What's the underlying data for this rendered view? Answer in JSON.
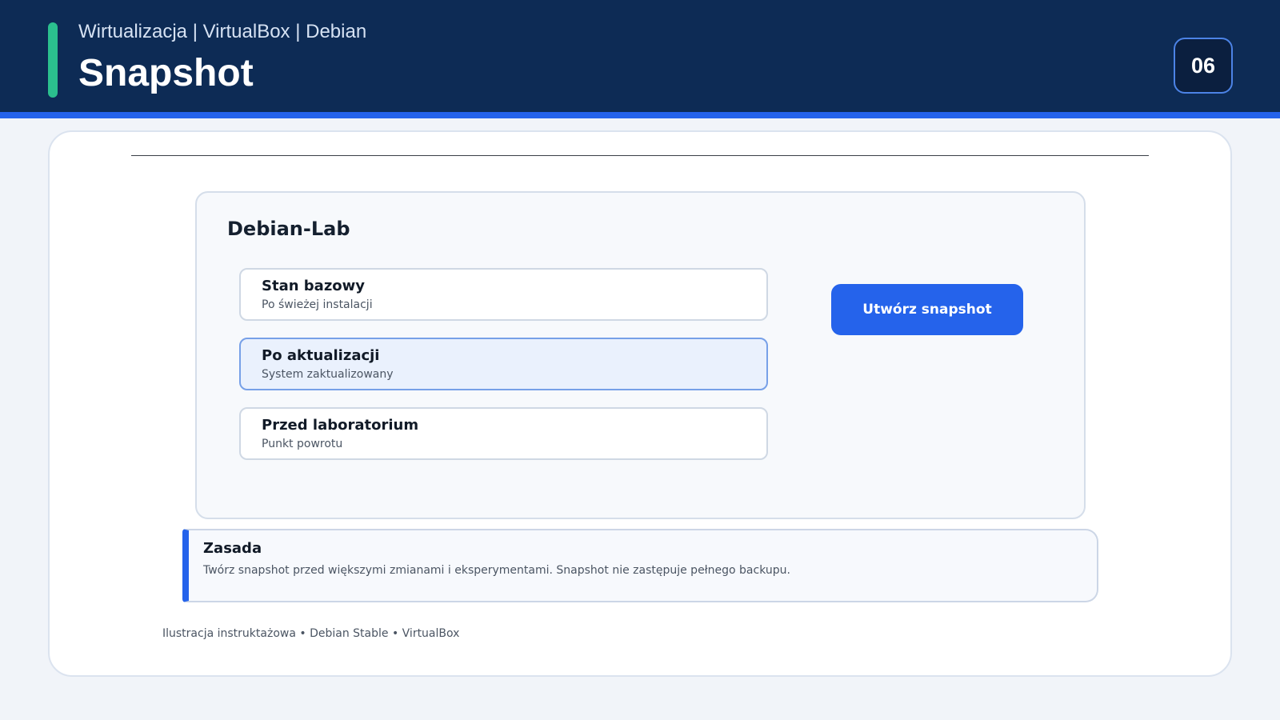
{
  "header": {
    "subtitle": "Wirtualizacja | VirtualBox | Debian",
    "title": "Snapshot",
    "page_number": "06"
  },
  "vm": {
    "name": "Debian-Lab",
    "snapshots": [
      {
        "title": "Stan bazowy",
        "description": "Po świeżej instalacji",
        "selected": false
      },
      {
        "title": "Po aktualizacji",
        "description": "System zaktualizowany",
        "selected": true
      },
      {
        "title": "Przed laboratorium",
        "description": "Punkt powrotu",
        "selected": false
      }
    ],
    "create_button_label": "Utwórz snapshot"
  },
  "rule": {
    "title": "Zasada",
    "text": "Twórz snapshot przed większymi zmianami i eksperymentami. Snapshot nie zastępuje pełnego backupu."
  },
  "footer": {
    "text": "Ilustracja instruktażowa • Debian Stable • VirtualBox"
  },
  "colors": {
    "header_background": "#0d2b55",
    "accent_blue": "#2563eb",
    "accent_green": "#2bbf8e",
    "selected_background": "#eaf1fd"
  }
}
